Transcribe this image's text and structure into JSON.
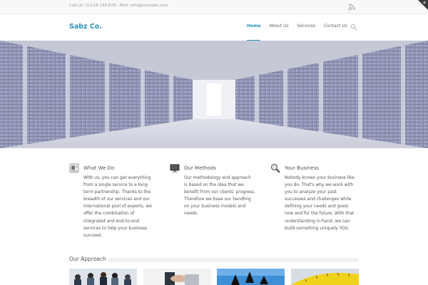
{
  "topbar": {
    "contact": "Call Us: (1)118 234 678 - Mail: info@example.com",
    "rss_icon": "rss-icon"
  },
  "header": {
    "logo": "Sabz Co.",
    "nav": [
      {
        "label": "Home",
        "active": true
      },
      {
        "label": "About Us",
        "active": false
      },
      {
        "label": "Services",
        "active": false
      },
      {
        "label": "Contact Us",
        "active": false
      }
    ],
    "search_icon": "search-icon"
  },
  "columns": [
    {
      "icon": "document-icon",
      "title": "What We Do",
      "text": "With us, you can get everything from a single service to a long-term partnership. Thanks to the breadth of our services and our international pool of experts, we offer the combination of integrated and end-to-end services to help your business succeed."
    },
    {
      "icon": "monitor-icon",
      "title": "Our Methods",
      "text": "Our methodology and approach is based on the idea that we benefit from our clients' progress. Therefore we base our handling on your business models and needs."
    },
    {
      "icon": "magnifier-icon",
      "title": "Your Business",
      "text": "Nobody knows your business like you do. That's why we work with you to analyze your past successes and challenges while defining your needs and goals now and for the future. With that understanding in hand, we can build something uniquely YOU."
    }
  ],
  "approach": {
    "title": "Our Approach",
    "thumbnails": [
      "team-meeting-photo",
      "handshake-photo",
      "jumping-people-photo",
      "measuring-tape-photo"
    ]
  },
  "colors": {
    "accent": "#2a92b8"
  }
}
